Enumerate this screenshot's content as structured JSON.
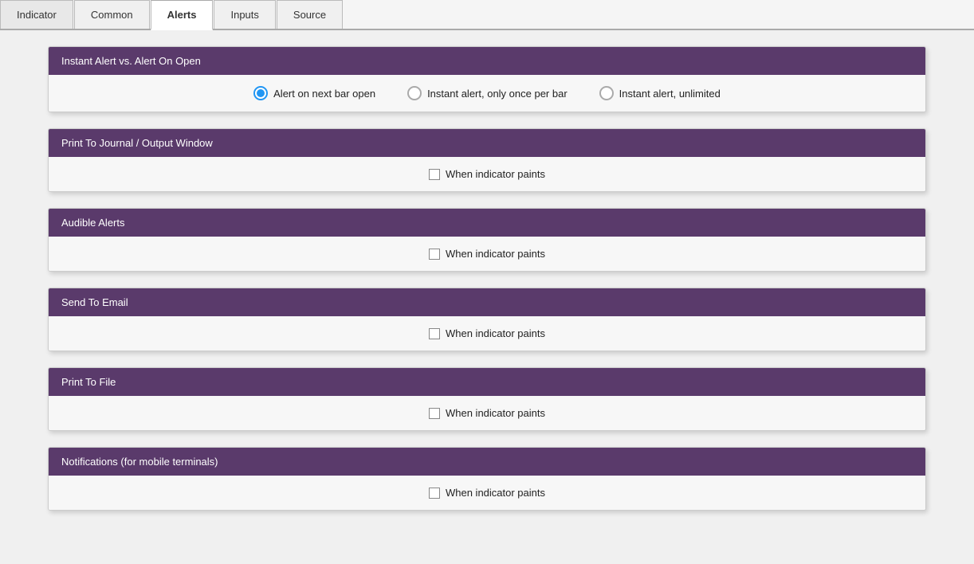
{
  "tabs": [
    {
      "id": "indicator",
      "label": "Indicator",
      "active": false
    },
    {
      "id": "common",
      "label": "Common",
      "active": false
    },
    {
      "id": "alerts",
      "label": "Alerts",
      "active": true
    },
    {
      "id": "inputs",
      "label": "Inputs",
      "active": false
    },
    {
      "id": "source",
      "label": "Source",
      "active": false
    }
  ],
  "sections": [
    {
      "id": "instant-alert",
      "title": "Instant Alert vs. Alert On Open",
      "type": "radio",
      "options": [
        {
          "id": "next-bar",
          "label": "Alert on next bar open",
          "checked": true
        },
        {
          "id": "once-per-bar",
          "label": "Instant alert, only once per bar",
          "checked": false
        },
        {
          "id": "unlimited",
          "label": "Instant alert, unlimited",
          "checked": false
        }
      ]
    },
    {
      "id": "print-journal",
      "title": "Print To Journal / Output Window",
      "type": "checkbox",
      "checkbox_label": "When indicator paints",
      "checked": false
    },
    {
      "id": "audible-alerts",
      "title": "Audible Alerts",
      "type": "checkbox",
      "checkbox_label": "When indicator paints",
      "checked": false
    },
    {
      "id": "send-email",
      "title": "Send To Email",
      "type": "checkbox",
      "checkbox_label": "When indicator paints",
      "checked": false
    },
    {
      "id": "print-file",
      "title": "Print To File",
      "type": "checkbox",
      "checkbox_label": "When indicator paints",
      "checked": false
    },
    {
      "id": "notifications",
      "title": "Notifications (for mobile terminals)",
      "type": "checkbox",
      "checkbox_label": "When indicator paints",
      "checked": false
    }
  ],
  "colors": {
    "header_bg": "#5a3a6b",
    "radio_active": "#2196F3"
  }
}
